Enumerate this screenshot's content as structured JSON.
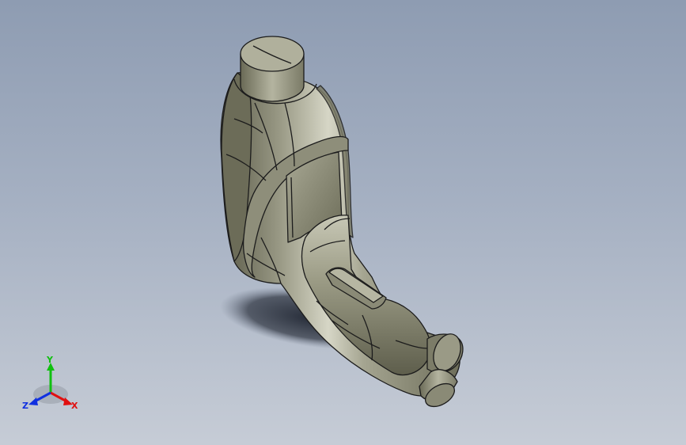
{
  "viewport": {
    "background_top": "#8e9cb2",
    "background_bottom": "#c6ccd6",
    "model_color": "#8d8d78",
    "edge_color": "#1c1c1c"
  },
  "triad": {
    "x_label": "X",
    "y_label": "Y",
    "z_label": "Z",
    "x_color": "#e01010",
    "y_color": "#10c010",
    "z_color": "#1030e0"
  }
}
